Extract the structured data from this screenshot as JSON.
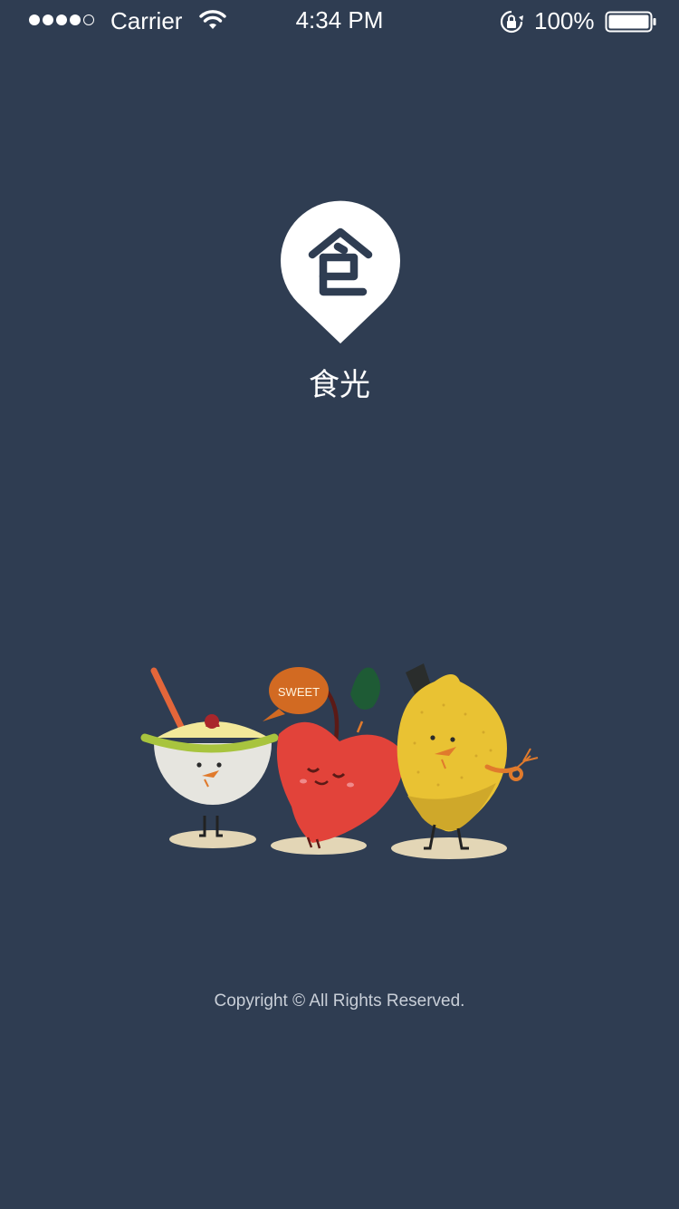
{
  "status_bar": {
    "carrier": "Carrier",
    "time": "4:34 PM",
    "battery": "100%",
    "signal_bars_filled": 4,
    "signal_bars_total": 5
  },
  "logo": {
    "app_name": "食光"
  },
  "illustration": {
    "speech_bubble": "SWEET"
  },
  "footer": {
    "copyright": "Copyright © All Rights Reserved."
  },
  "colors": {
    "background": "#2f3d52",
    "logo_mark": "#2f3d52",
    "apple": "#e2433a",
    "lemon": "#e9c233",
    "bubble": "#d26a22"
  }
}
